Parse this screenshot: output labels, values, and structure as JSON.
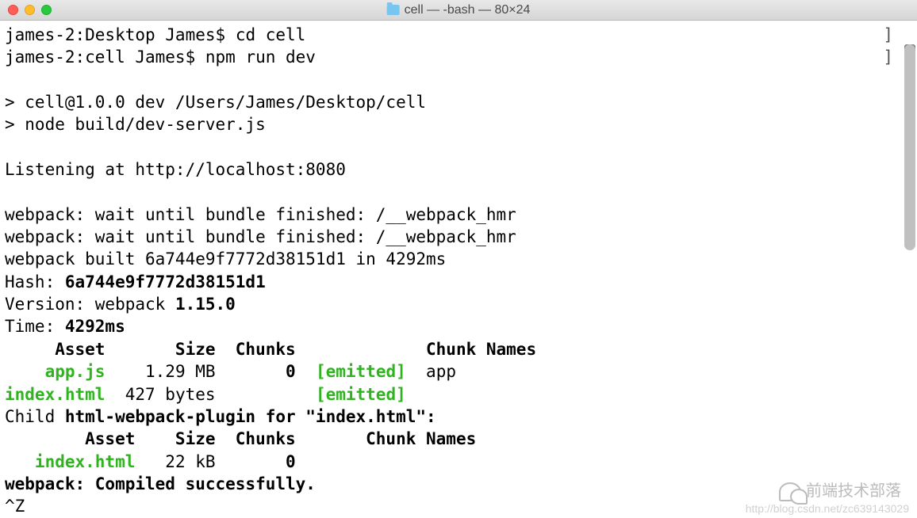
{
  "window": {
    "title": "cell — -bash — 80×24"
  },
  "terminal": {
    "prompt1_host": "james-2:Desktop James$",
    "prompt1_cmd": "cd cell",
    "prompt2_host": "james-2:cell James$",
    "prompt2_cmd": "npm run dev",
    "npm_line1": "> cell@1.0.0 dev /Users/James/Desktop/cell",
    "npm_line2": "> node build/dev-server.js",
    "listening": "Listening at http://localhost:8080",
    "wait1": "webpack: wait until bundle finished: /__webpack_hmr",
    "wait2": "webpack: wait until bundle finished: /__webpack_hmr",
    "built": "webpack built 6a744e9f7772d38151d1 in 4292ms",
    "hash_label": "Hash: ",
    "hash_value": "6a744e9f7772d38151d1",
    "version_label": "Version: webpack ",
    "version_value": "1.15.0",
    "time_label": "Time: ",
    "time_value": "4292ms",
    "table_header": "     Asset       Size  Chunks             Chunk Names",
    "row1_asset": "    app.js",
    "row1_size": "    1.29 MB       ",
    "row1_chunk": "0",
    "row1_emitted": "  [emitted]  ",
    "row1_name": "app",
    "row2_asset": "index.html",
    "row2_size": "  427 bytes          ",
    "row2_emitted": "[emitted]",
    "child_prefix": "Child ",
    "child_bold": "html-webpack-plugin for \"index.html\":",
    "child_header": "        Asset    Size  Chunks       Chunk Names",
    "child_row_asset": "   index.html",
    "child_row_rest": "   22 kB       ",
    "child_row_chunk": "0",
    "compiled": "webpack: Compiled successfully.",
    "suspend": "^Z",
    "bracket": "]"
  },
  "watermark": {
    "text": "前端技术部落",
    "url": "http://blog.csdn.net/zc639143029"
  }
}
